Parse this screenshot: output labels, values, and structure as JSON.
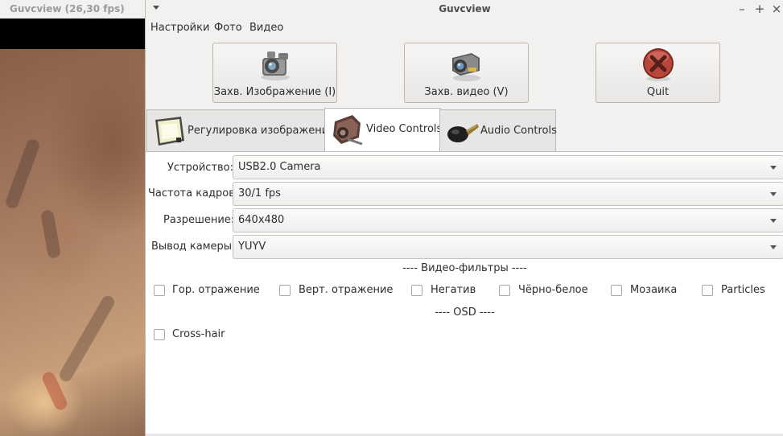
{
  "preview_window": {
    "title": "Guvcview  (26,30 fps)"
  },
  "window": {
    "title": "Guvcview",
    "controls": {
      "minimize": "–",
      "maximize": "+",
      "close": "×"
    }
  },
  "menu": {
    "items": [
      "Настройки",
      "Фото",
      "Видео"
    ]
  },
  "buttons": {
    "capture_image": "Захв. Изображение (I)",
    "capture_video": "Захв. видео (V)",
    "quit": "Quit"
  },
  "tabs": [
    {
      "label": "Регулировка изображения",
      "icon": "tv-icon",
      "active": false
    },
    {
      "label": "Video Controls",
      "icon": "camcorder-icon",
      "active": true
    },
    {
      "label": "Audio Controls",
      "icon": "microphone-icon",
      "active": false
    }
  ],
  "video_controls": {
    "device": {
      "label": "Устройство:",
      "value": "USB2.0 Camera"
    },
    "frame_rate": {
      "label": "Частота кадров:",
      "value": "30/1 fps"
    },
    "resolution": {
      "label": "Разрешение:",
      "value": "640x480"
    },
    "camera_output": {
      "label": "Вывод камеры:",
      "value": "YUYV"
    },
    "filters_title": "---- Видео-фильтры ----",
    "filters": [
      {
        "label": "Гор. отражение",
        "checked": false
      },
      {
        "label": "Верт. отражение",
        "checked": false
      },
      {
        "label": "Негатив",
        "checked": false
      },
      {
        "label": "Чёрно-белое",
        "checked": false
      },
      {
        "label": "Мозаика",
        "checked": false
      },
      {
        "label": "Particles",
        "checked": false
      }
    ],
    "osd_title": "---- OSD ----",
    "osd": [
      {
        "label": "Cross-hair",
        "checked": false
      }
    ]
  }
}
